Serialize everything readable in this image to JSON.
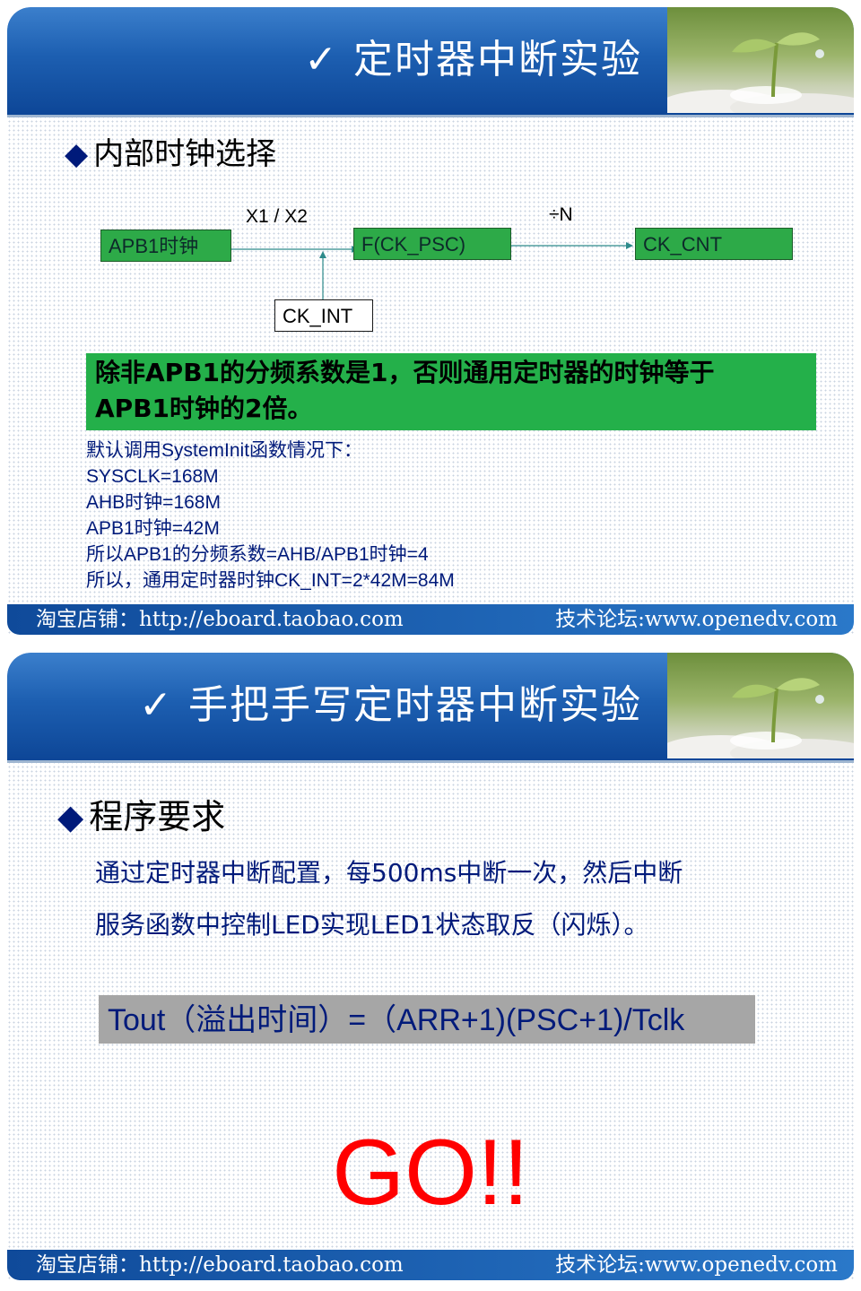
{
  "slide1": {
    "title": "✓  定时器中断实验",
    "section": "内部时钟选择",
    "diagram": {
      "apb1_clock": "APB1时钟",
      "multiplier": "X1 / X2",
      "f_ck_psc": "F(CK_PSC)",
      "divider": "÷N",
      "ck_cnt": "CK_CNT",
      "ck_int": "CK_INT"
    },
    "note_line1": "除非APB1的分频系数是1，否则通用定时器的时钟等于",
    "note_line2": "APB1时钟的2倍。",
    "info": [
      "默认调用SystemInit函数情况下：",
      "SYSCLK=168M",
      "AHB时钟=168M",
      "APB1时钟=42M",
      "所以APB1的分频系数=AHB/APB1时钟=4",
      "所以，通用定时器时钟CK_INT=2*42M=84M"
    ]
  },
  "slide2": {
    "title": "✓  手把手写定时器中断实验",
    "section": "程序要求",
    "line1": "通过定时器中断配置，每500ms中断一次，然后中断",
    "line2": "服务函数中控制LED实现LED1状态取反（闪烁）。",
    "formula": "Tout（溢出时间）=（ARR+1)(PSC+1)/Tclk",
    "go": "GO!!"
  },
  "footer": {
    "left": "淘宝店铺：http://eboard.taobao.com",
    "right": "技术论坛:www.openedv.com"
  },
  "colors": {
    "header_blue": "#1d5fb1",
    "green_box": "#2daa48",
    "text_navy": "#001a7a",
    "go_red": "#ff0000",
    "formula_bg": "#a6a6a6"
  }
}
